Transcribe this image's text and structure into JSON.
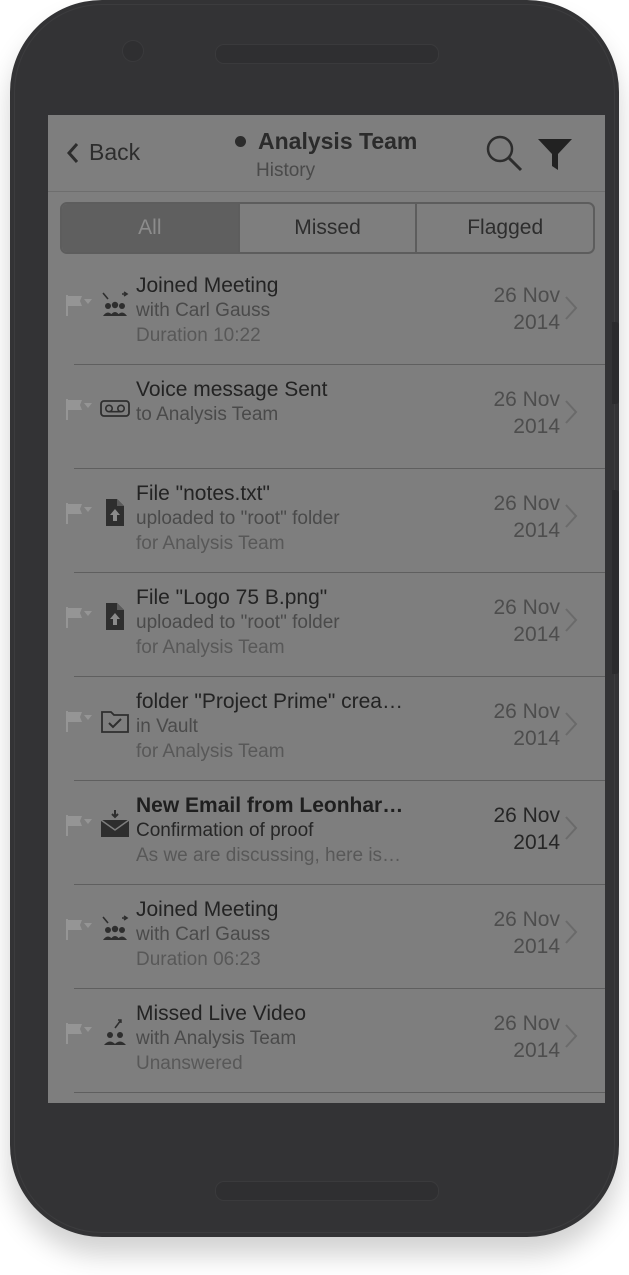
{
  "header": {
    "back_label": "Back",
    "title": "Analysis Team",
    "subtitle": "History",
    "search_icon": "search-icon",
    "filter_icon": "filter-icon"
  },
  "tabs": [
    {
      "label": "All",
      "active": true
    },
    {
      "label": "Missed",
      "active": false
    },
    {
      "label": "Flagged",
      "active": false
    }
  ],
  "items": [
    {
      "icon": "meeting-icon",
      "line1": "Joined Meeting",
      "line2": "with Carl Gauss",
      "line3": "Duration 10:22",
      "date": "26 Nov",
      "year": "2014",
      "bold": false
    },
    {
      "icon": "voicemail-icon",
      "line1": "Voice message Sent",
      "line2": "to Analysis Team",
      "line3": "",
      "date": "26 Nov",
      "year": "2014",
      "bold": false
    },
    {
      "icon": "file-upload-icon",
      "line1": "File \"notes.txt\"",
      "line2": "uploaded to \"root\" folder",
      "line3": "for Analysis Team",
      "date": "26 Nov",
      "year": "2014",
      "bold": false
    },
    {
      "icon": "file-upload-icon",
      "line1": "File \"Logo 75 B.png\"",
      "line2": "uploaded to \"root\" folder",
      "line3": "for Analysis Team",
      "date": "26 Nov",
      "year": "2014",
      "bold": false
    },
    {
      "icon": "folder-check-icon",
      "line1": "folder \"Project Prime\" crea…",
      "line2": "in Vault",
      "line3": "for Analysis Team",
      "date": "26 Nov",
      "year": "2014",
      "bold": false
    },
    {
      "icon": "email-icon",
      "line1": "New Email from Leonhar…",
      "line2": "Confirmation of proof",
      "line3": "As we are discussing, here is…",
      "date": "26 Nov",
      "year": "2014",
      "bold": true
    },
    {
      "icon": "meeting-icon",
      "line1": "Joined Meeting",
      "line2": "with Carl Gauss",
      "line3": "Duration 06:23",
      "date": "26 Nov",
      "year": "2014",
      "bold": false
    },
    {
      "icon": "missed-video-icon",
      "line1": "Missed Live Video",
      "line2": "with Analysis Team",
      "line3": "Unanswered",
      "date": "26 Nov",
      "year": "2014",
      "bold": false
    }
  ]
}
